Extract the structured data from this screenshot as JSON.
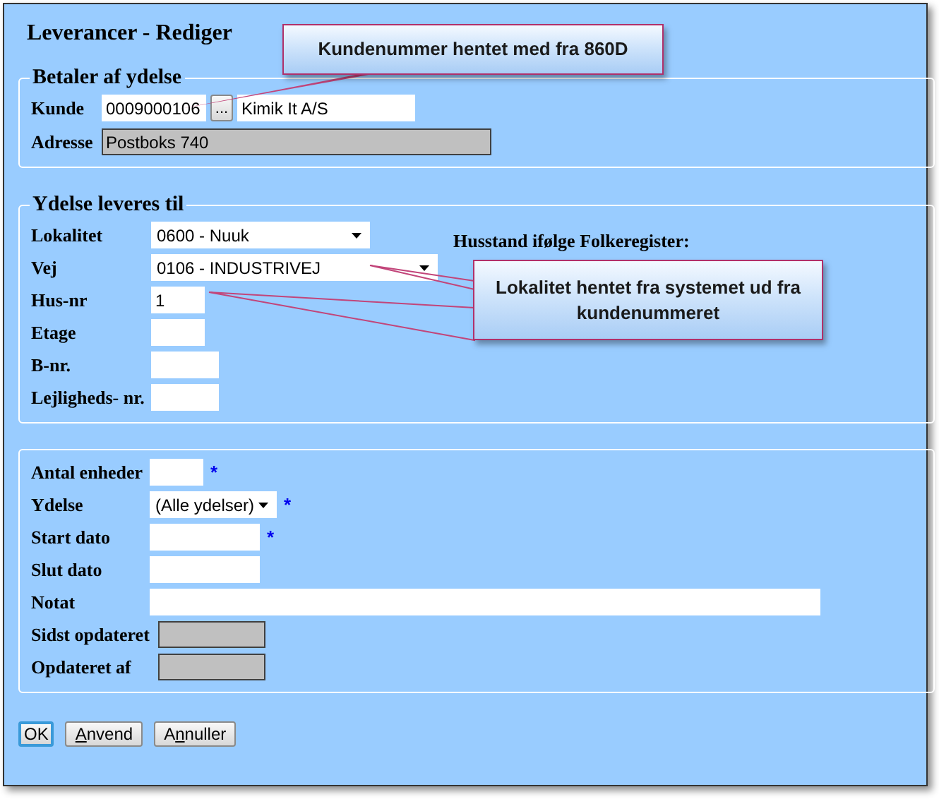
{
  "window": {
    "title": "Leverancer - Rediger"
  },
  "sections": [
    {
      "legend": "Betaler af ydelse",
      "rows": [
        {
          "label": "Kunde",
          "controls": [
            {
              "kind": "text",
              "value": "0009000106"
            },
            {
              "kind": "button",
              "label": "..."
            },
            {
              "kind": "text",
              "value": "Kimik It A/S"
            }
          ]
        },
        {
          "label": "Adresse",
          "controls": [
            {
              "kind": "readonly",
              "value": "Postboks 740"
            }
          ]
        }
      ]
    },
    {
      "legend": "Ydelse leveres til",
      "aside": "Husstand ifølge Folkeregister:",
      "rows": [
        {
          "label": "Lokalitet",
          "controls": [
            {
              "kind": "select",
              "value": "0600 - Nuuk"
            }
          ]
        },
        {
          "label": "Vej",
          "controls": [
            {
              "kind": "select",
              "value": "0106 - INDUSTRIVEJ"
            }
          ]
        },
        {
          "label": "Hus-nr",
          "controls": [
            {
              "kind": "text",
              "value": "1"
            }
          ]
        },
        {
          "label": "Etage",
          "controls": [
            {
              "kind": "text"
            }
          ]
        },
        {
          "label": "B-nr.",
          "controls": [
            {
              "kind": "text"
            }
          ]
        },
        {
          "label": "Lejligheds- nr.",
          "controls": [
            {
              "kind": "text"
            }
          ]
        }
      ]
    },
    {
      "rows": [
        {
          "label": "Antal enheder",
          "controls": [
            {
              "kind": "text"
            },
            {
              "kind": "required",
              "mark": "*"
            }
          ]
        },
        {
          "label": "Ydelse",
          "controls": [
            {
              "kind": "select",
              "value": "(Alle ydelser)"
            },
            {
              "kind": "required",
              "mark": "*"
            }
          ]
        },
        {
          "label": "Start dato",
          "controls": [
            {
              "kind": "text"
            },
            {
              "kind": "required",
              "mark": "*"
            }
          ]
        },
        {
          "label": "Slut dato",
          "controls": [
            {
              "kind": "text"
            }
          ]
        },
        {
          "label": "Notat",
          "controls": [
            {
              "kind": "text"
            }
          ]
        },
        {
          "label": "Sidst opdateret",
          "controls": [
            {
              "kind": "readonly"
            }
          ]
        },
        {
          "label": "Opdateret af",
          "controls": [
            {
              "kind": "readonly"
            }
          ]
        }
      ]
    }
  ],
  "buttons": [
    {
      "key": "O",
      "post": "K",
      "underlined": false,
      "focused": true
    },
    {
      "key": "A",
      "post": "nvend",
      "underlined": true,
      "focused": false
    },
    {
      "pre": "A",
      "key": "n",
      "post": "nuller",
      "underlined": true,
      "focused": false
    }
  ],
  "callouts": [
    {
      "text": "Kundenummer hentet med fra 860D"
    },
    {
      "text": "Lokalitet hentet fra systemet ud fra kundenummeret"
    }
  ]
}
